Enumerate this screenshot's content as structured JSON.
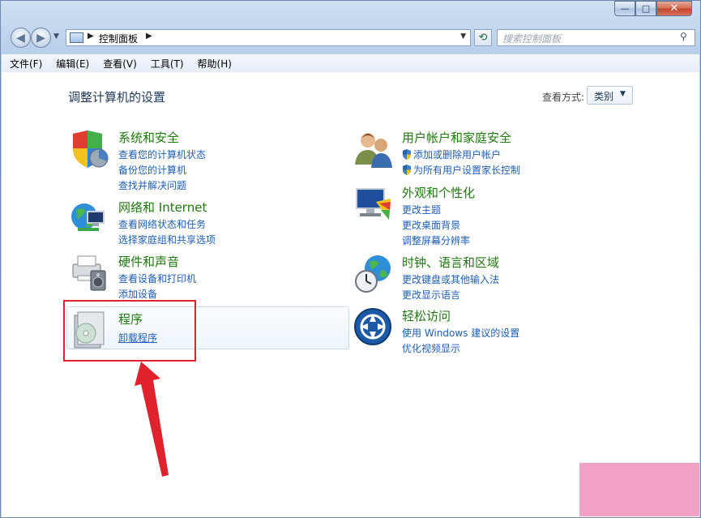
{
  "window": {
    "caption_buttons": {
      "minimize": "—",
      "maximize": "□",
      "close": "✕"
    }
  },
  "navigation": {
    "back_icon": "back-arrow-icon",
    "forward_icon": "forward-arrow-icon",
    "breadcrumb": "控制面板",
    "search_placeholder": "搜索控制面板"
  },
  "menu": [
    "文件(F)",
    "编辑(E)",
    "查看(V)",
    "工具(T)",
    "帮助(H)"
  ],
  "header": {
    "title": "调整计算机的设置",
    "view_by_label": "查看方式:",
    "view_by_value": "类别"
  },
  "categories": {
    "system_security": {
      "title": "系统和安全",
      "links": [
        "查看您的计算机状态",
        "备份您的计算机",
        "查找并解决问题"
      ]
    },
    "network": {
      "title": "网络和 Internet",
      "links": [
        "查看网络状态和任务",
        "选择家庭组和共享选项"
      ]
    },
    "hardware": {
      "title": "硬件和声音",
      "links": [
        "查看设备和打印机",
        "添加设备"
      ]
    },
    "programs": {
      "title": "程序",
      "links": [
        "卸载程序"
      ]
    },
    "user_accounts": {
      "title": "用户帐户和家庭安全",
      "links": [
        "添加或删除用户帐户",
        "为所有用户设置家长控制"
      ]
    },
    "appearance": {
      "title": "外观和个性化",
      "links": [
        "更改主题",
        "更改桌面背景",
        "调整屏幕分辨率"
      ]
    },
    "clock_region": {
      "title": "时钟、语言和区域",
      "links": [
        "更改键盘或其他输入法",
        "更改显示语言"
      ]
    },
    "ease_access": {
      "title": "轻松访问",
      "links": [
        "使用 Windows 建议的设置",
        "优化视频显示"
      ]
    }
  },
  "colors": {
    "category_title": "#1e7a0c",
    "link": "#1e5eb8",
    "annotation": "#e0212e"
  }
}
